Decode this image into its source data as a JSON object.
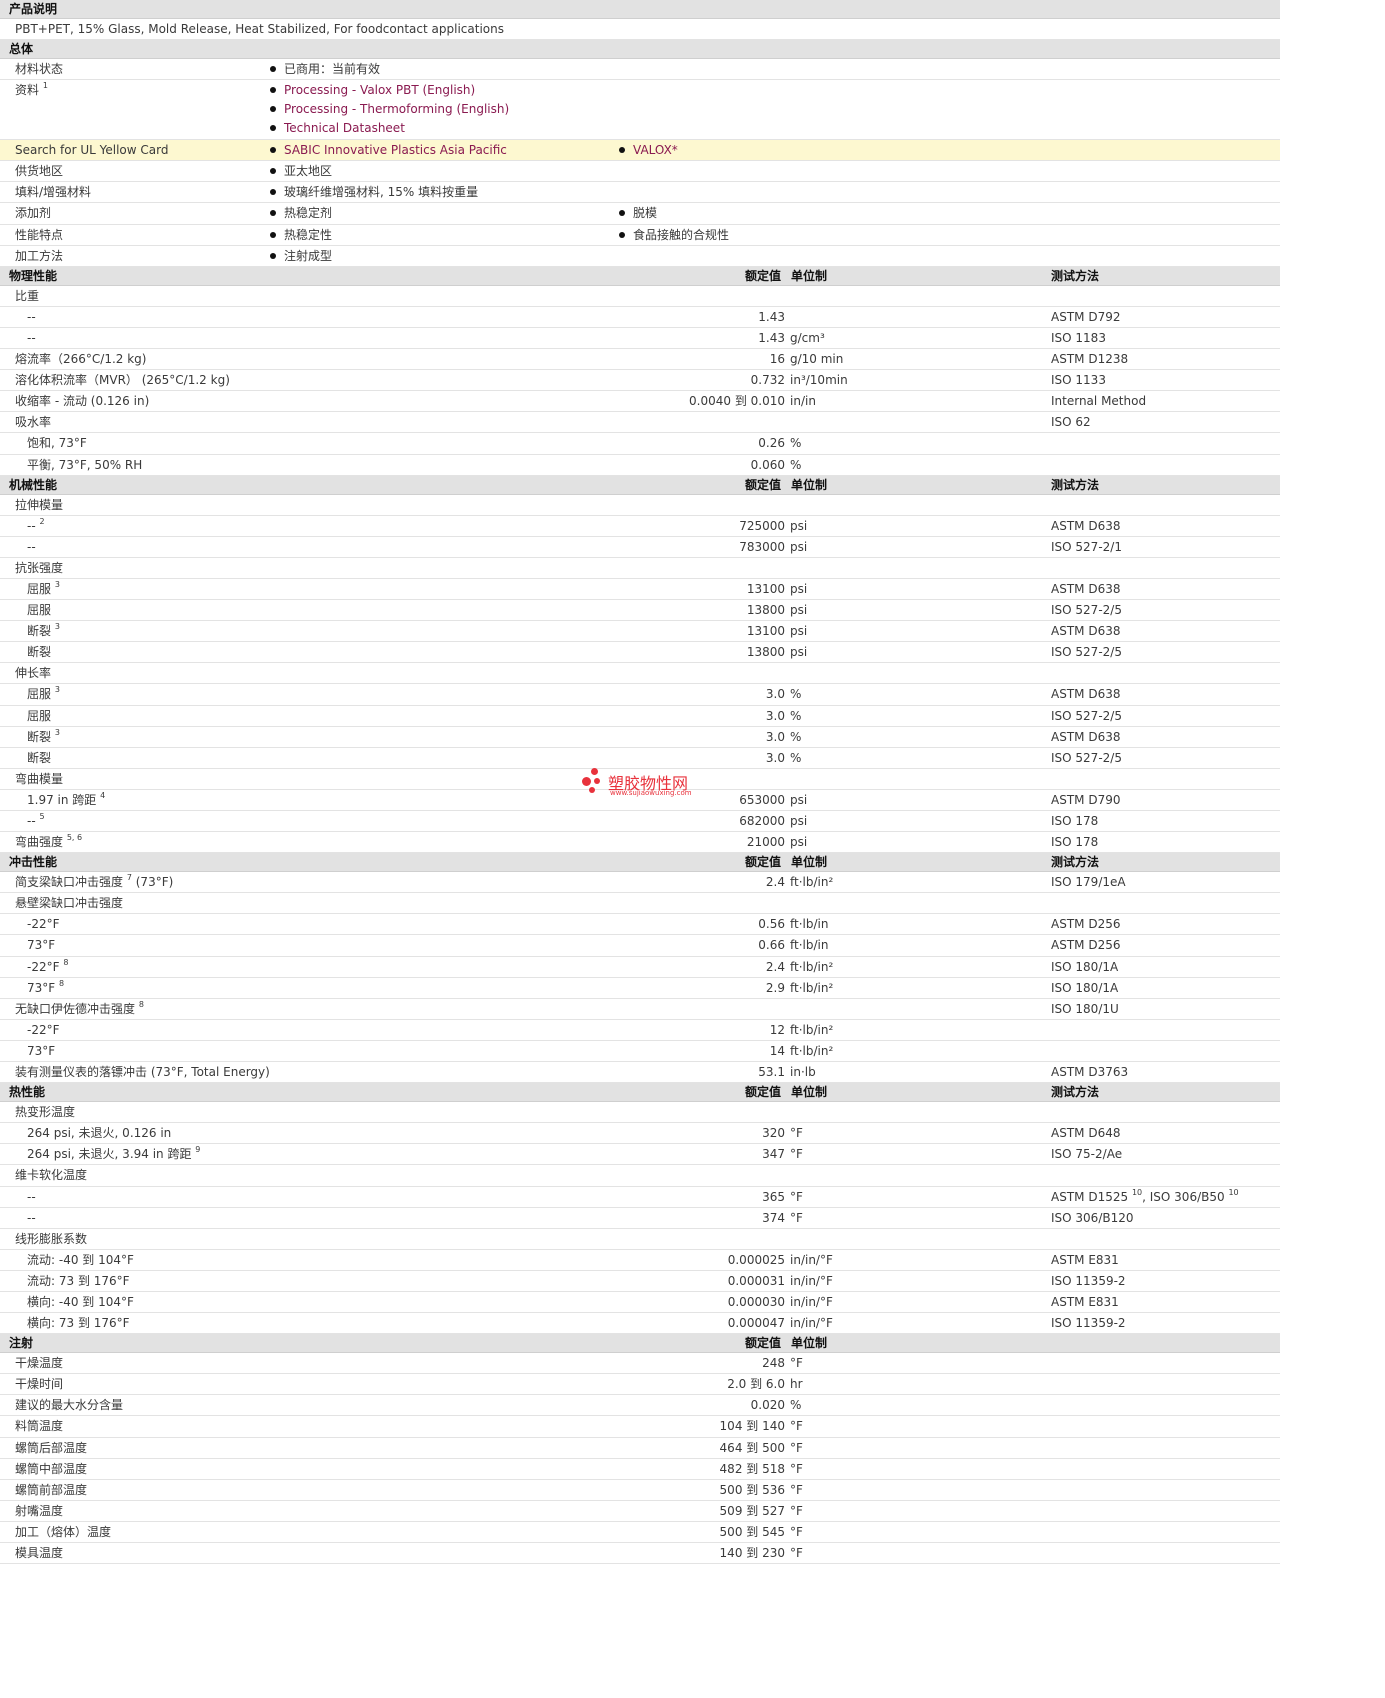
{
  "description": {
    "header": "产品说明",
    "text": "PBT+PET, 15% Glass, Mold Release, Heat Stabilized, For foodcontact applications"
  },
  "general": {
    "header": "总体",
    "rows": [
      {
        "label": "材料状态",
        "items": [
          "已商用：当前有效"
        ]
      },
      {
        "label": "资料",
        "note": "1",
        "links": [
          "Processing - Valox PBT (English)",
          "Processing - Thermoforming (English)",
          "Technical Datasheet"
        ]
      },
      {
        "label": "Search for UL Yellow Card",
        "links": [
          "SABIC Innovative Plastics Asia Pacific",
          "VALOX*"
        ]
      },
      {
        "label": "供货地区",
        "items": [
          "亚太地区"
        ]
      },
      {
        "label": "填料/增强材料",
        "items": [
          "玻璃纤维增强材料, 15% 填料按重量"
        ]
      },
      {
        "label": "添加剂",
        "items": [
          "热稳定剂",
          "脱模"
        ]
      },
      {
        "label": "性能特点",
        "items": [
          "热稳定性",
          "食品接触的合规性"
        ]
      },
      {
        "label": "加工方法",
        "items": [
          "注射成型"
        ]
      }
    ]
  },
  "columns": {
    "value": "额定值",
    "unit": "单位制",
    "method": "测试方法"
  },
  "physical": {
    "header": "物理性能",
    "rows": [
      {
        "label": "比重"
      },
      {
        "label": "--",
        "sub": true,
        "value": "1.43",
        "unit": "",
        "method": "ASTM D792"
      },
      {
        "label": "--",
        "sub": true,
        "value": "1.43",
        "unit": "g/cm³",
        "method": "ISO 1183"
      },
      {
        "label": "熔流率（266°C/1.2 kg)",
        "value": "16",
        "unit": "g/10 min",
        "method": "ASTM D1238"
      },
      {
        "label": "溶化体积流率（MVR） (265°C/1.2 kg)",
        "value": "0.732",
        "unit": "in³/10min",
        "method": "ISO 1133"
      },
      {
        "label": "收缩率 - 流动 (0.126 in)",
        "value": "0.0040 到  0.010",
        "unit": "in/in",
        "method": "Internal Method"
      },
      {
        "label": "吸水率",
        "method": "ISO 62"
      },
      {
        "label": "饱和, 73°F",
        "sub": true,
        "value": "0.26",
        "unit": "%"
      },
      {
        "label": "平衡, 73°F, 50% RH",
        "sub": true,
        "value": "0.060",
        "unit": "%"
      }
    ]
  },
  "mechanical": {
    "header": "机械性能",
    "rows": [
      {
        "label": "拉伸模量"
      },
      {
        "label": "--",
        "note": "2",
        "sub": true,
        "value": "725000",
        "unit": "psi",
        "method": "ASTM D638"
      },
      {
        "label": "--",
        "sub": true,
        "value": "783000",
        "unit": "psi",
        "method": "ISO 527-2/1"
      },
      {
        "label": "抗张强度"
      },
      {
        "label": "屈服",
        "note": "3",
        "sub": true,
        "value": "13100",
        "unit": "psi",
        "method": "ASTM D638"
      },
      {
        "label": "屈服",
        "sub": true,
        "value": "13800",
        "unit": "psi",
        "method": "ISO 527-2/5"
      },
      {
        "label": "断裂",
        "note": "3",
        "sub": true,
        "value": "13100",
        "unit": "psi",
        "method": "ASTM D638"
      },
      {
        "label": "断裂",
        "sub": true,
        "value": "13800",
        "unit": "psi",
        "method": "ISO 527-2/5"
      },
      {
        "label": "伸长率"
      },
      {
        "label": "屈服",
        "note": "3",
        "sub": true,
        "value": "3.0",
        "unit": "%",
        "method": "ASTM D638"
      },
      {
        "label": "屈服",
        "sub": true,
        "value": "3.0",
        "unit": "%",
        "method": "ISO 527-2/5"
      },
      {
        "label": "断裂",
        "note": "3",
        "sub": true,
        "value": "3.0",
        "unit": "%",
        "method": "ASTM D638"
      },
      {
        "label": "断裂",
        "sub": true,
        "value": "3.0",
        "unit": "%",
        "method": "ISO 527-2/5"
      },
      {
        "label": "弯曲模量"
      },
      {
        "label": "1.97 in 跨距",
        "note": "4",
        "sub": true,
        "value": "653000",
        "unit": "psi",
        "method": "ASTM D790"
      },
      {
        "label": "--",
        "note": "5",
        "sub": true,
        "value": "682000",
        "unit": "psi",
        "method": "ISO 178"
      },
      {
        "label": "弯曲强度",
        "note": "5, 6",
        "value": "21000",
        "unit": "psi",
        "method": "ISO 178"
      }
    ]
  },
  "impact": {
    "header": "冲击性能",
    "rows": [
      {
        "label": "简支梁缺口冲击强度",
        "note": "7",
        "suffix": " (73°F)",
        "value": "2.4",
        "unit": "ft·lb/in²",
        "method": "ISO 179/1eA"
      },
      {
        "label": "悬壁梁缺口冲击强度"
      },
      {
        "label": "-22°F",
        "sub": true,
        "value": "0.56",
        "unit": "ft·lb/in",
        "method": "ASTM D256"
      },
      {
        "label": "73°F",
        "sub": true,
        "value": "0.66",
        "unit": "ft·lb/in",
        "method": "ASTM D256"
      },
      {
        "label": "-22°F",
        "note": "8",
        "sub": true,
        "value": "2.4",
        "unit": "ft·lb/in²",
        "method": "ISO 180/1A"
      },
      {
        "label": "73°F",
        "note": "8",
        "sub": true,
        "value": "2.9",
        "unit": "ft·lb/in²",
        "method": "ISO 180/1A"
      },
      {
        "label": "无缺口伊佐德冲击强度",
        "note": "8",
        "method": "ISO 180/1U"
      },
      {
        "label": "-22°F",
        "sub": true,
        "value": "12",
        "unit": "ft·lb/in²"
      },
      {
        "label": "73°F",
        "sub": true,
        "value": "14",
        "unit": "ft·lb/in²"
      },
      {
        "label": "装有测量仪表的落镖冲击 (73°F, Total Energy)",
        "value": "53.1",
        "unit": "in·lb",
        "method": "ASTM D3763"
      }
    ]
  },
  "thermal": {
    "header": "热性能",
    "rows": [
      {
        "label": "热变形温度"
      },
      {
        "label": "264 psi, 未退火, 0.126 in",
        "sub": true,
        "value": "320",
        "unit": "°F",
        "method": "ASTM D648"
      },
      {
        "label": "264 psi, 未退火, 3.94 in 跨距",
        "note": "9",
        "sub": true,
        "value": "347",
        "unit": "°F",
        "method": "ISO 75-2/Ae"
      },
      {
        "label": "维卡软化温度"
      },
      {
        "label": "--",
        "sub": true,
        "value": "365",
        "unit": "°F",
        "method": "ASTM D1525",
        "mnote": "10",
        "method2": ", ISO 306/B50",
        "mnote2": "10"
      },
      {
        "label": "--",
        "sub": true,
        "value": "374",
        "unit": "°F",
        "method": "ISO 306/B120"
      },
      {
        "label": "线形膨胀系数"
      },
      {
        "label": "流动: -40 到  104°F",
        "sub": true,
        "value": "0.000025",
        "unit": "in/in/°F",
        "method": "ASTM E831"
      },
      {
        "label": "流动: 73 到  176°F",
        "sub": true,
        "value": "0.000031",
        "unit": "in/in/°F",
        "method": "ISO 11359-2"
      },
      {
        "label": "横向: -40 到  104°F",
        "sub": true,
        "value": "0.000030",
        "unit": "in/in/°F",
        "method": "ASTM E831"
      },
      {
        "label": "横向: 73 到  176°F",
        "sub": true,
        "value": "0.000047",
        "unit": "in/in/°F",
        "method": "ISO 11359-2"
      }
    ]
  },
  "injection": {
    "header": "注射",
    "rows": [
      {
        "label": "干燥温度",
        "value": "248",
        "unit": "°F"
      },
      {
        "label": "干燥时间",
        "value": "2.0 到  6.0",
        "unit": "hr"
      },
      {
        "label": "建议的最大水分含量",
        "value": "0.020",
        "unit": "%"
      },
      {
        "label": "料筒温度",
        "value": "104 到  140",
        "unit": "°F"
      },
      {
        "label": "螺筒后部温度",
        "value": "464 到  500",
        "unit": "°F"
      },
      {
        "label": "螺筒中部温度",
        "value": "482 到  518",
        "unit": "°F"
      },
      {
        "label": "螺筒前部温度",
        "value": "500 到  536",
        "unit": "°F"
      },
      {
        "label": "射嘴温度",
        "value": "509 到  527",
        "unit": "°F"
      },
      {
        "label": "加工（熔体）温度",
        "value": "500 到  545",
        "unit": "°F"
      },
      {
        "label": "模具温度",
        "value": "140 到  230",
        "unit": "°F"
      }
    ]
  },
  "watermark": {
    "title": "塑胶物性网",
    "url": "www.sujiaowuxing.com"
  },
  "colors": {
    "header_bg": "#e2e2e2",
    "link": "#8a1a50",
    "highlight_bg": "#fdf8d0",
    "watermark": "#e8323c"
  }
}
